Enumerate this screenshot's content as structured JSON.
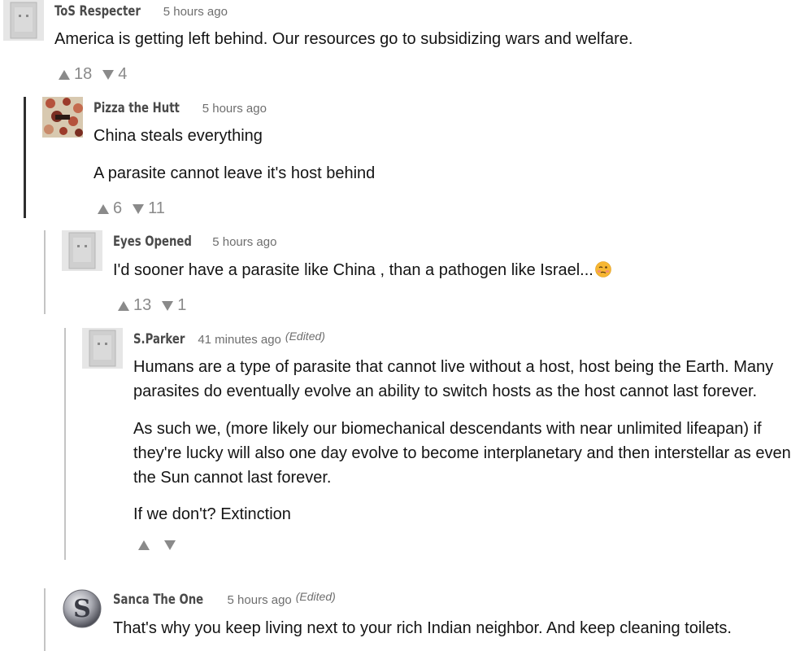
{
  "comments": [
    {
      "author": "ToS Respecter",
      "time": "5 hours ago",
      "paragraphs": [
        "America is getting left behind. Our resources go to subsidizing wars and welfare."
      ],
      "upvotes": "18",
      "downvotes": "4",
      "avatar": "square-block-avatar"
    },
    {
      "author": "Pizza the Hutt",
      "time": "5 hours ago",
      "paragraphs": [
        "China steals everything",
        "A parasite cannot leave it's host behind"
      ],
      "upvotes": "6",
      "downvotes": "11",
      "avatar": "pizza-avatar"
    },
    {
      "author": "Eyes Opened",
      "time": "5 hours ago",
      "paragraphs": [
        "I'd sooner have a parasite like China , than a pathogen like Israel..."
      ],
      "emoji": "woozy-face-emoji",
      "upvotes": "13",
      "downvotes": "1",
      "avatar": "square-block-avatar"
    },
    {
      "author": "S.Parker",
      "time": "41 minutes ago",
      "edited": "(Edited)",
      "paragraphs": [
        "Humans are a type of parasite that cannot live without a host, host being the Earth. Many",
        "parasites do eventually evolve an ability to switch hosts as the host cannot last forever.",
        "As such we, (more likely our biomechanical descendants with near unlimited lifeapan) if",
        "they're lucky will also one day evolve to become interplanetary and then interstellar as even",
        "the Sun cannot last forever.",
        "If we don't? Extinction"
      ],
      "upvotes": "",
      "downvotes": "",
      "avatar": "square-block-avatar"
    },
    {
      "author": "Sanca The One",
      "time": "5 hours ago",
      "edited": "(Edited)",
      "paragraphs": [
        "That's why you keep living next to your rich Indian neighbor. And keep cleaning toilets."
      ],
      "avatar": "silver-s-logo-avatar"
    }
  ],
  "colors": {
    "accent_thread": "#2e2e2e",
    "thread_line": "#c4c4c4",
    "vote_gray": "#8a8a8a"
  }
}
